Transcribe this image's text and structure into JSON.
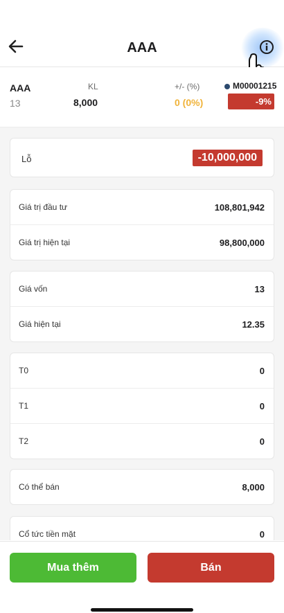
{
  "header": {
    "title": "AAA"
  },
  "summary": {
    "symbol": "AAA",
    "symbol_sub": "13",
    "kl_label": "KL",
    "kl_value": "8,000",
    "change_label": "+/- (%)",
    "change_value": "0 (0%)",
    "account": "M00001215",
    "percent_badge": "-9%"
  },
  "loss": {
    "label": "Lỗ",
    "value": "-10,000,000"
  },
  "group1": [
    {
      "label": "Giá trị đầu tư",
      "value": "108,801,942"
    },
    {
      "label": "Giá trị hiện tại",
      "value": "98,800,000"
    }
  ],
  "group2": [
    {
      "label": "Giá vốn",
      "value": "13"
    },
    {
      "label": "Giá hiện tại",
      "value": "12.35"
    }
  ],
  "group3": [
    {
      "label": "T0",
      "value": "0"
    },
    {
      "label": "T1",
      "value": "0"
    },
    {
      "label": "T2",
      "value": "0"
    }
  ],
  "group4": [
    {
      "label": "Có thể bán",
      "value": "8,000"
    }
  ],
  "group5": [
    {
      "label": "Cổ tức tiền mặt",
      "value": "0"
    }
  ],
  "footer": {
    "buy_label": "Mua thêm",
    "sell_label": "Bán"
  },
  "colors": {
    "red": "#c43a2f",
    "green": "#4dba35",
    "amber": "#f0b33a"
  }
}
